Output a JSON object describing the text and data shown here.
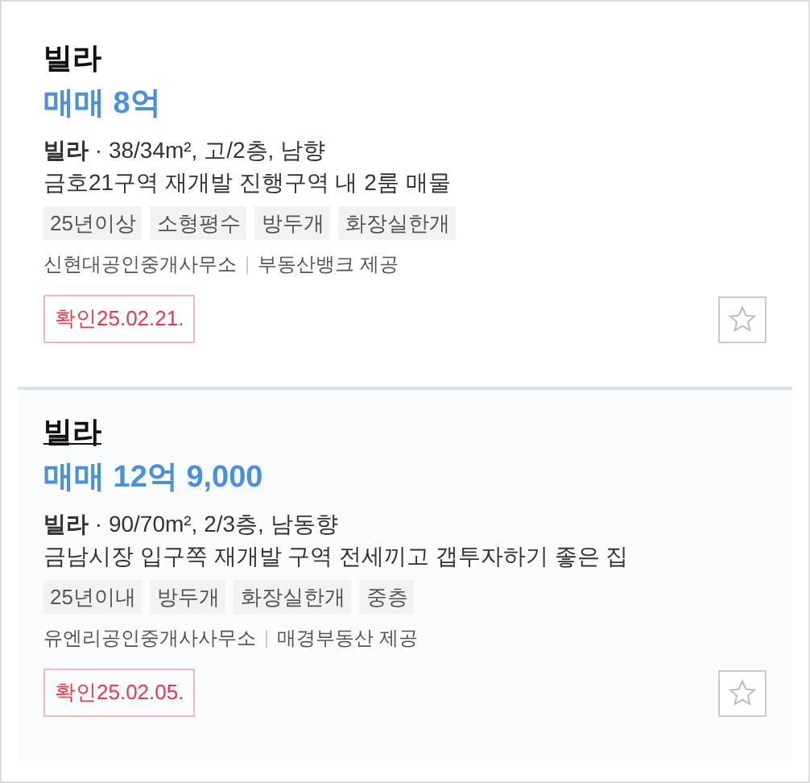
{
  "listings": [
    {
      "title": "빌라",
      "price": "매매 8억",
      "spec": "**빌라** · 38/34m², 고/2층, 남향",
      "description": "금호21구역 재개발 진행구역 내 2룸 매물",
      "tags": [
        "25년이상",
        "소형평수",
        "방두개",
        "화장실한개"
      ],
      "agent": "신현대공인중개사무소",
      "provider": "부동산뱅크 제공",
      "confirmed": "확인25.02.21.",
      "favorite": false,
      "selected": false
    },
    {
      "title": "빌라",
      "price": "매매 12억 9,000",
      "spec": "**빌라** · 90/70m², 2/3층, 남동향",
      "description": "금남시장 입구쪽 재개발 구역 전세끼고 갭투자하기 좋은 집",
      "tags": [
        "25년이내",
        "방두개",
        "화장실한개",
        "중층"
      ],
      "agent": "유엔리공인중개사사무소",
      "provider": "매경부동산 제공",
      "confirmed": "확인25.02.05.",
      "favorite": false,
      "selected": true
    }
  ]
}
